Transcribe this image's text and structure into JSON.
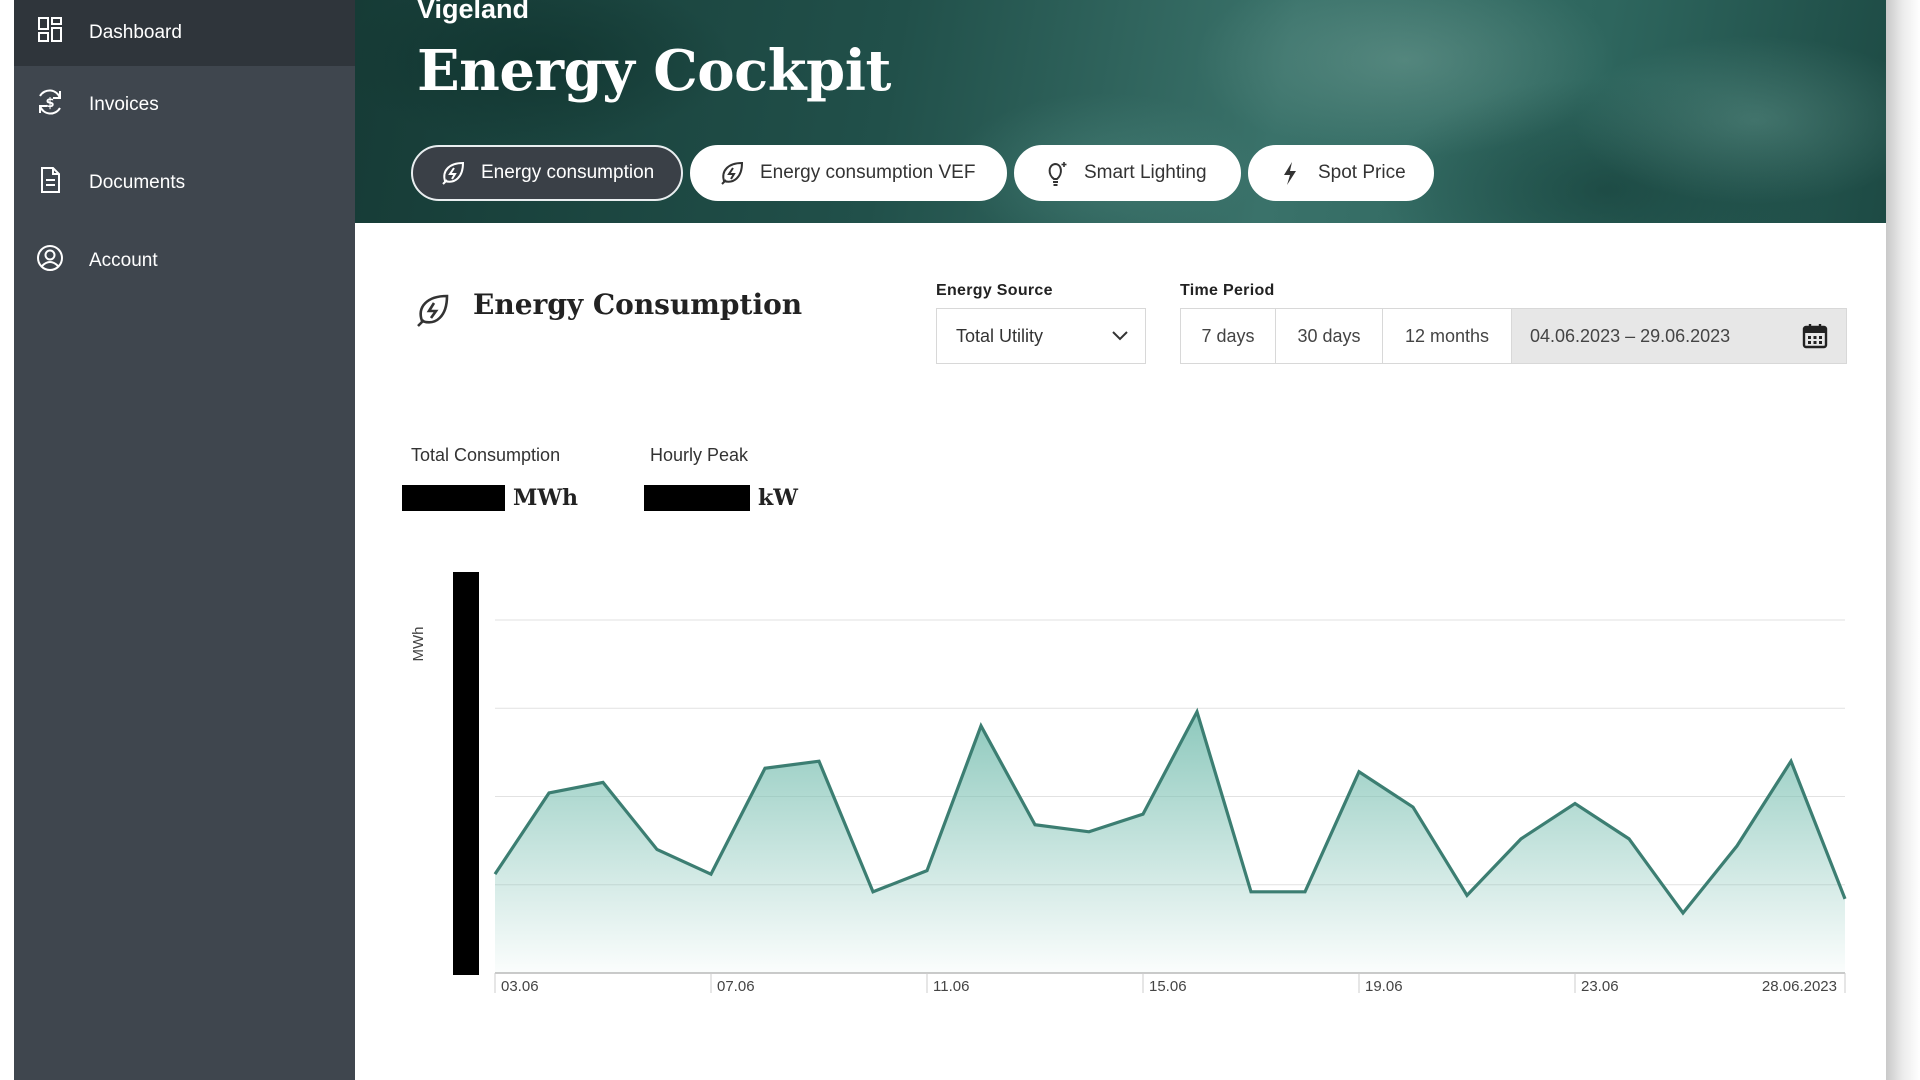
{
  "sidebar": {
    "items": [
      {
        "label": "Dashboard",
        "icon": "dashboard-icon",
        "active": true
      },
      {
        "label": "Invoices",
        "icon": "invoices-icon",
        "active": false
      },
      {
        "label": "Documents",
        "icon": "document-icon",
        "active": false
      },
      {
        "label": "Account",
        "icon": "account-icon",
        "active": false
      }
    ]
  },
  "header": {
    "company": "Vigeland",
    "title": "Energy Cockpit",
    "tabs": [
      {
        "label": "Energy consumption",
        "icon": "leaf-bolt-icon",
        "active": true
      },
      {
        "label": "Energy consumption VEF",
        "icon": "leaf-bolt-icon",
        "active": false
      },
      {
        "label": "Smart Lighting",
        "icon": "bulb-icon",
        "active": false
      },
      {
        "label": "Spot Price",
        "icon": "bolt-icon",
        "active": false
      }
    ]
  },
  "section": {
    "title": "Energy Consumption",
    "energy_source": {
      "label": "Energy Source",
      "value": "Total Utility"
    },
    "time_period": {
      "label": "Time Period",
      "options": [
        "7 days",
        "30 days",
        "12 months"
      ],
      "range": "04.06.2023 – 29.06.2023"
    }
  },
  "kpis": {
    "total": {
      "label": "Total Consumption",
      "unit": "MWh"
    },
    "peak": {
      "label": "Hourly Peak",
      "unit": "kW"
    }
  },
  "colors": {
    "accent": "#3c7e72",
    "fill_top": "#79bfb1",
    "sidebar": "#3f464e",
    "sidebar_active": "#2f353b"
  },
  "chart_data": {
    "type": "area",
    "ylabel": "MWh",
    "y_ticks_redacted": true,
    "x": [
      "03.06",
      "04.06",
      "05.06",
      "06.06",
      "07.06",
      "08.06",
      "09.06",
      "10.06",
      "11.06",
      "12.06",
      "13.06",
      "14.06",
      "15.06",
      "16.06",
      "17.06",
      "18.06",
      "19.06",
      "20.06",
      "21.06",
      "22.06",
      "23.06",
      "24.06",
      "25.06",
      "26.06",
      "27.06",
      "28.06.2023"
    ],
    "xticks": [
      "03.06",
      "07.06",
      "11.06",
      "15.06",
      "19.06",
      "23.06",
      "28.06.2023"
    ],
    "series": [
      {
        "values": [
          0.28,
          0.51,
          0.54,
          0.35,
          0.28,
          0.58,
          0.6,
          0.23,
          0.29,
          0.7,
          0.42,
          0.4,
          0.45,
          0.74,
          0.23,
          0.23,
          0.57,
          0.47,
          0.22,
          0.38,
          0.48,
          0.38,
          0.17,
          0.36,
          0.6,
          0.21
        ]
      }
    ],
    "ylim": [
      0,
      1
    ],
    "grid": true
  }
}
